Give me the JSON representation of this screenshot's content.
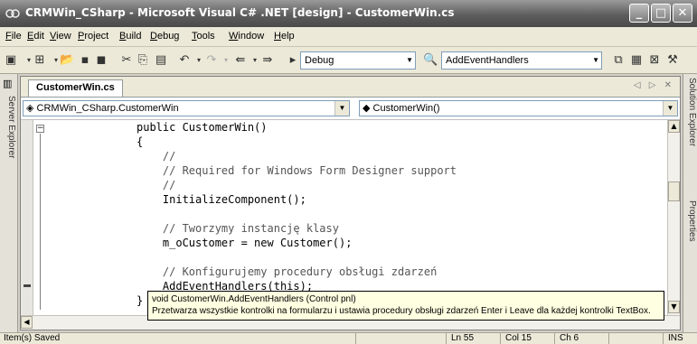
{
  "window": {
    "title": "CRMWin_CSharp - Microsoft Visual C# .NET [design] - CustomerWin.cs",
    "min_label": "_",
    "max_label": "□",
    "close_label": "✕"
  },
  "menu": {
    "items": [
      {
        "u": "F",
        "rest": "ile"
      },
      {
        "u": "E",
        "rest": "dit"
      },
      {
        "u": "V",
        "rest": "iew"
      },
      {
        "u": "P",
        "rest": "roject"
      },
      {
        "u": "B",
        "rest": "uild"
      },
      {
        "u": "D",
        "rest": "ebug"
      },
      {
        "u": "T",
        "rest": "ools"
      },
      {
        "u": "W",
        "rest": "indow"
      },
      {
        "u": "H",
        "rest": "elp"
      }
    ]
  },
  "toolbar": {
    "config_value": "Debug",
    "find_value": "AddEventHandlers",
    "icons": [
      "new-project-icon",
      "add-item-icon",
      "open-icon",
      "save-icon",
      "save-all-icon",
      "cut-icon",
      "copy-icon",
      "paste-icon",
      "undo-icon",
      "redo-icon",
      "navigate-back-icon",
      "navigate-forward-icon",
      "start-icon",
      "find-icon",
      "solution-explorer-icon",
      "properties-icon",
      "toolbox-icon",
      "class-view-icon"
    ]
  },
  "left_panel": {
    "label": "Server Explorer"
  },
  "right_panel": {
    "solution_label": "Solution Explorer",
    "properties_label": "Properties"
  },
  "document": {
    "tab_label": "CustomerWin.cs",
    "nav_controls": "◁ ▷ ✕",
    "class_combo": "CRMWin_CSharp.CustomerWin",
    "member_combo": "CustomerWin()"
  },
  "code": {
    "lines": [
      {
        "text": "public CustomerWin()",
        "kind": "code"
      },
      {
        "text": "{",
        "kind": "code"
      },
      {
        "text": "    //",
        "kind": "comment"
      },
      {
        "text": "    // Required for Windows Form Designer support",
        "kind": "comment"
      },
      {
        "text": "    //",
        "kind": "comment"
      },
      {
        "text": "    InitializeComponent();",
        "kind": "code"
      },
      {
        "text": "",
        "kind": "code"
      },
      {
        "text": "    // Tworzymy instancję klasy",
        "kind": "comment"
      },
      {
        "text": "    m_oCustomer = new Customer();",
        "kind": "code"
      },
      {
        "text": "",
        "kind": "code"
      },
      {
        "text": "    // Konfigurujemy procedury obsługi zdarzeń",
        "kind": "comment"
      },
      {
        "text": "    AddEventHandlers(this);",
        "kind": "code"
      },
      {
        "text": "}",
        "kind": "code"
      }
    ]
  },
  "tooltip": {
    "signature": "void CustomerWin.AddEventHandlers (Control pnl)",
    "description": "Przetwarza wszystkie kontrolki na formularzu i ustawia procedury obsługi zdarzeń Enter i Leave dla każdej kontrolki TextBox."
  },
  "status": {
    "message": "Item(s) Saved",
    "line": "Ln 55",
    "col": "Col 15",
    "ch": "Ch 6",
    "mode": "INS"
  }
}
